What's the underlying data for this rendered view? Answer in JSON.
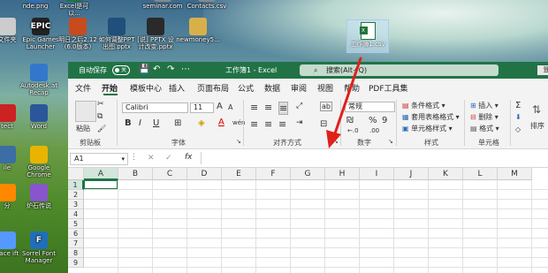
{
  "desktop": {
    "top_icons": [
      {
        "label": "nde.png",
        "color": "#2f6fbf",
        "icon": "image-icon"
      },
      {
        "label": "Excel是可以...",
        "color": "#217346",
        "icon": "excel-icon"
      },
      {
        "label": "seminar.com",
        "color": "#888888",
        "icon": "file-icon"
      },
      {
        "label": "Contacts.csv",
        "color": "#888888",
        "icon": "file-icon"
      }
    ],
    "row2_icons": [
      {
        "label": "文件夹",
        "color": "#cccccc",
        "icon": "folder-icon"
      },
      {
        "label": "Epic Games Launcher",
        "color": "#222222",
        "glyph": "EPIC",
        "icon": "epic-icon"
      },
      {
        "label": "明日之后2.12 (6.0版本)",
        "color": "#c84b1e",
        "icon": "game-icon"
      },
      {
        "label": "如何调整PPT出图.pptx",
        "color": "#1f4f7a",
        "icon": "pptx-icon"
      },
      {
        "label": "[说] PPTX 设计改变.pptx",
        "color": "#2a2a2a",
        "icon": "pptx-icon"
      },
      {
        "label": "newmoney5...",
        "color": "#d8b04a",
        "icon": "folder-icon"
      }
    ],
    "left_icons": [
      {
        "label": "Autodesk.at Recap",
        "color": "#3377cc",
        "icon": "autodesk-icon"
      },
      {
        "label": "tect",
        "color": "#cc2222",
        "icon": "app-icon"
      },
      {
        "label": "Word",
        "color": "#2b579a",
        "icon": "word-icon"
      },
      {
        "label": "ile",
        "color": "#3b6ea5",
        "icon": "app-icon"
      },
      {
        "label": "Google Chrome",
        "color": "#e8b400",
        "icon": "chrome-icon"
      },
      {
        "label": "分",
        "color": "#ff8800",
        "icon": "app-icon"
      },
      {
        "label": "炉石传说",
        "color": "#8855cc",
        "icon": "game-icon"
      },
      {
        "label": "pace ift",
        "color": "#5599ff",
        "icon": "app-icon"
      },
      {
        "label": "Sorrel Font Manager",
        "color": "#1f6fb8",
        "glyph": "F",
        "icon": "font-manager-icon"
      }
    ],
    "csv_file": {
      "label": "工作簿1.csv"
    }
  },
  "titlebar": {
    "autosave": "自动保存",
    "toggle": "关",
    "save_glyph": "💾",
    "undo_glyph": "↶",
    "redo_glyph": "↷",
    "more_glyph": "⋯",
    "title": "工作簿1 - Excel",
    "search_icon": "⌕",
    "search_placeholder": "搜索(Alt+Q)",
    "login": "登"
  },
  "tabs": [
    "文件",
    "开始",
    "模板中心",
    "插入",
    "页面布局",
    "公式",
    "数据",
    "审阅",
    "视图",
    "帮助",
    "PDF工具集"
  ],
  "active_tab": "开始",
  "ribbon": {
    "clipboard": {
      "paste": "粘贴",
      "cut": "✂",
      "copy": "⧉",
      "brush": "🖌",
      "label": "剪贴板"
    },
    "font": {
      "name": "Calibri",
      "size": "11",
      "grow": "A",
      "shrink": "A",
      "bold": "B",
      "italic": "I",
      "underline": "U",
      "border": "⊞",
      "fill": "◈",
      "color": "A",
      "phonetic": "wén",
      "label": "字体"
    },
    "align": {
      "label": "对齐方式",
      "wrap": "ab",
      "merge": "⊟"
    },
    "number": {
      "format": "常规",
      "currency": "₪",
      "percent": "%",
      "comma": "9",
      "inc": "←.0",
      "dec": ".00",
      "label": "数字"
    },
    "styles": {
      "conditional": "条件格式",
      "table": "套用表格格式",
      "cell": "单元格样式",
      "label": "样式"
    },
    "cells": {
      "insert": "插入",
      "delete": "删除",
      "format": "格式",
      "label": "单元格"
    },
    "editing": {
      "sort": "排序"
    }
  },
  "formula_bar": {
    "name_box": "A1",
    "cancel": "✕",
    "enter": "✓",
    "fx": "fx",
    "value": ""
  },
  "grid": {
    "columns": [
      "A",
      "B",
      "C",
      "D",
      "E",
      "F",
      "G",
      "H",
      "I",
      "J",
      "K",
      "L",
      "M"
    ],
    "rows": [
      "1",
      "2",
      "3",
      "4",
      "5",
      "6",
      "7",
      "8",
      "9"
    ]
  },
  "annotation": {
    "arrow_color": "#e0201b"
  }
}
